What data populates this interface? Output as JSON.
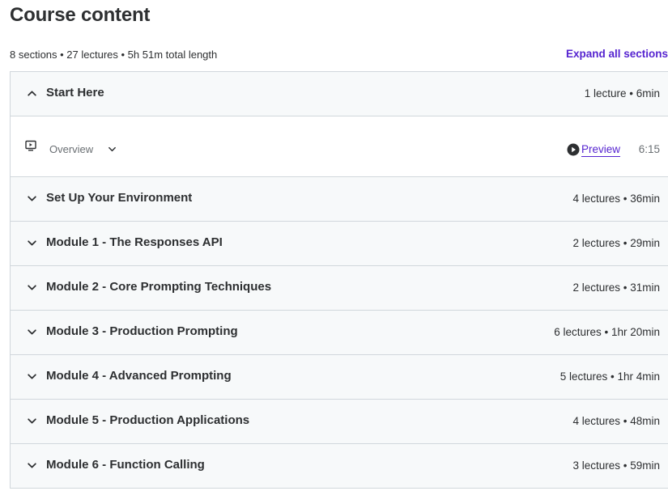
{
  "header": {
    "title": "Course content",
    "summary": "8 sections • 27 lectures • 5h 51m total length",
    "expand_all": "Expand all sections"
  },
  "sections": [
    {
      "title": "Start Here",
      "meta": "1 lecture • 6min",
      "expanded": true,
      "lectures": [
        {
          "title": "Overview",
          "preview": "Preview",
          "duration": "6:15"
        }
      ]
    },
    {
      "title": "Set Up Your Environment",
      "meta": "4 lectures • 36min",
      "expanded": false
    },
    {
      "title": "Module 1 - The Responses API",
      "meta": "2 lectures • 29min",
      "expanded": false
    },
    {
      "title": "Module 2 - Core Prompting Techniques",
      "meta": "2 lectures • 31min",
      "expanded": false
    },
    {
      "title": "Module 3 - Production Prompting",
      "meta": "6 lectures • 1hr 20min",
      "expanded": false
    },
    {
      "title": "Module 4 - Advanced Prompting",
      "meta": "5 lectures • 1hr 4min",
      "expanded": false
    },
    {
      "title": "Module 5 - Production Applications",
      "meta": "4 lectures • 48min",
      "expanded": false
    },
    {
      "title": "Module 6 - Function Calling",
      "meta": "3 lectures • 59min",
      "expanded": false
    }
  ],
  "icons": {
    "chevron_up": "chevron-up-icon",
    "chevron_down": "chevron-down-icon",
    "video": "video-icon",
    "play": "play-circle-icon"
  },
  "colors": {
    "accent": "#5624d0",
    "text": "#2d2f31",
    "muted": "#6a6f73",
    "header_bg": "#f7f9fa",
    "border": "#d1d7dc"
  }
}
